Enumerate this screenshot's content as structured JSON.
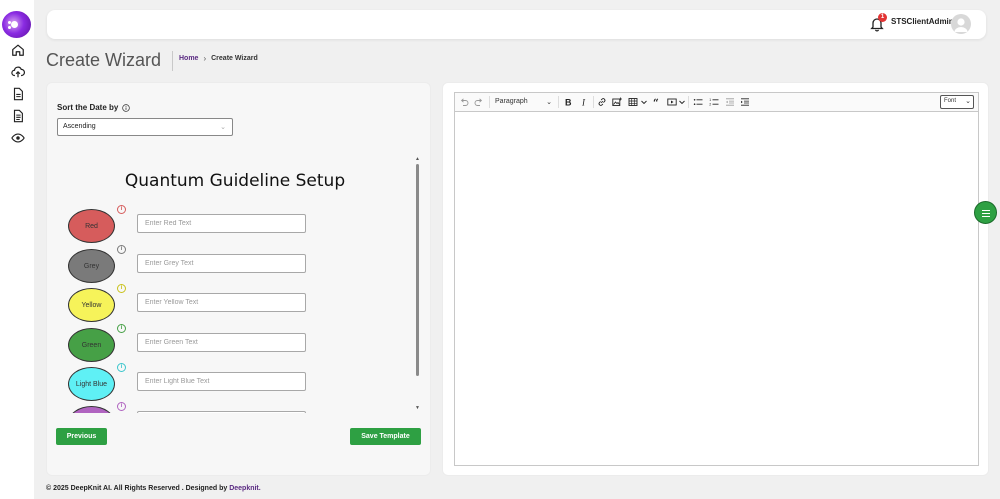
{
  "header": {
    "username": "STSClientAdmin",
    "notification_count": "1"
  },
  "page": {
    "title": "Create Wizard",
    "breadcrumb": {
      "home": "Home",
      "current": "Create Wizard"
    }
  },
  "sort": {
    "label": "Sort the Date by",
    "selected": "Ascending"
  },
  "form": {
    "title": "Quantum Guideline Setup",
    "rows": [
      {
        "label": "Red",
        "placeholder": "Enter Red Text",
        "color": "#d65c5c",
        "info_color": "#d65c5c"
      },
      {
        "label": "Grey",
        "placeholder": "Enter Grey Text",
        "color": "#7a7a7a",
        "info_color": "#7a7a7a"
      },
      {
        "label": "Yellow",
        "placeholder": "Enter Yellow Text",
        "color": "#f6f35a",
        "info_color": "#c9c21c"
      },
      {
        "label": "Green",
        "placeholder": "Enter Green Text",
        "color": "#46a046",
        "info_color": "#46a046"
      },
      {
        "label": "Light Blue",
        "placeholder": "Enter Light Blue Text",
        "color": "#5ff0f5",
        "info_color": "#3cc6cc"
      },
      {
        "label": "",
        "placeholder": "",
        "color": "#b064c0",
        "info_color": "#b064c0"
      }
    ]
  },
  "buttons": {
    "previous": "Previous",
    "save": "Save Template"
  },
  "editor": {
    "block_format": "Paragraph",
    "font": "Font"
  },
  "footer": {
    "text": "© 2025 DeepKnit AI. All Rights Reserved . Designed by ",
    "brand": "Deepknit."
  },
  "colors": {
    "accent_green": "#2ea043",
    "brand_purple": "#5a2a82"
  }
}
